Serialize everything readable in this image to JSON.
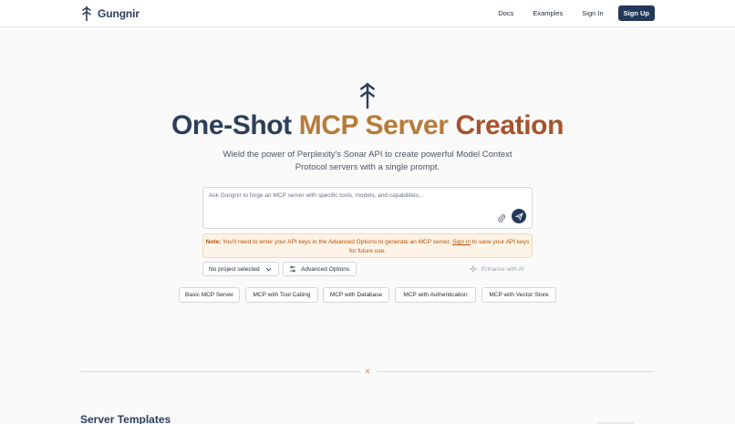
{
  "header": {
    "brand": "Gungnir",
    "nav": [
      "Docs",
      "Examples",
      "Sign In"
    ],
    "signup": "Sign Up"
  },
  "hero": {
    "title_part1": "One-Shot",
    "title_part2": "MCP Server",
    "title_part3": "Creation",
    "subtitle": "Wield the power of Perplexity's Sonar API to create powerful Model Context Protocol servers with a single prompt."
  },
  "prompt": {
    "placeholder": "Ask Gungnir to forge an MCP server with specific tools, models, and capabilities...",
    "attach_icon": "paperclip-icon",
    "send_icon": "send-icon"
  },
  "note": {
    "label": "Note:",
    "text_before": " You'll need to enter your API keys in the Advanced Options to generate an MCP server. ",
    "link": "Sign in",
    "text_after": " to save your API keys for future use."
  },
  "options": {
    "project": "No project selected",
    "advanced": "Advanced Options",
    "enhance": "Enhance with AI"
  },
  "templates": [
    "Basic MCP Server",
    "MCP with Tool Calling",
    "MCP with Database",
    "MCP with Authentication",
    "MCP with Vector Store"
  ],
  "section": {
    "title": "Server Templates"
  },
  "colors": {
    "brand_navy": "#24395a",
    "title_gold": "#b77a3a",
    "title_rust": "#a7522a",
    "note_bg": "#fdf3e6",
    "note_text": "#b45309"
  }
}
